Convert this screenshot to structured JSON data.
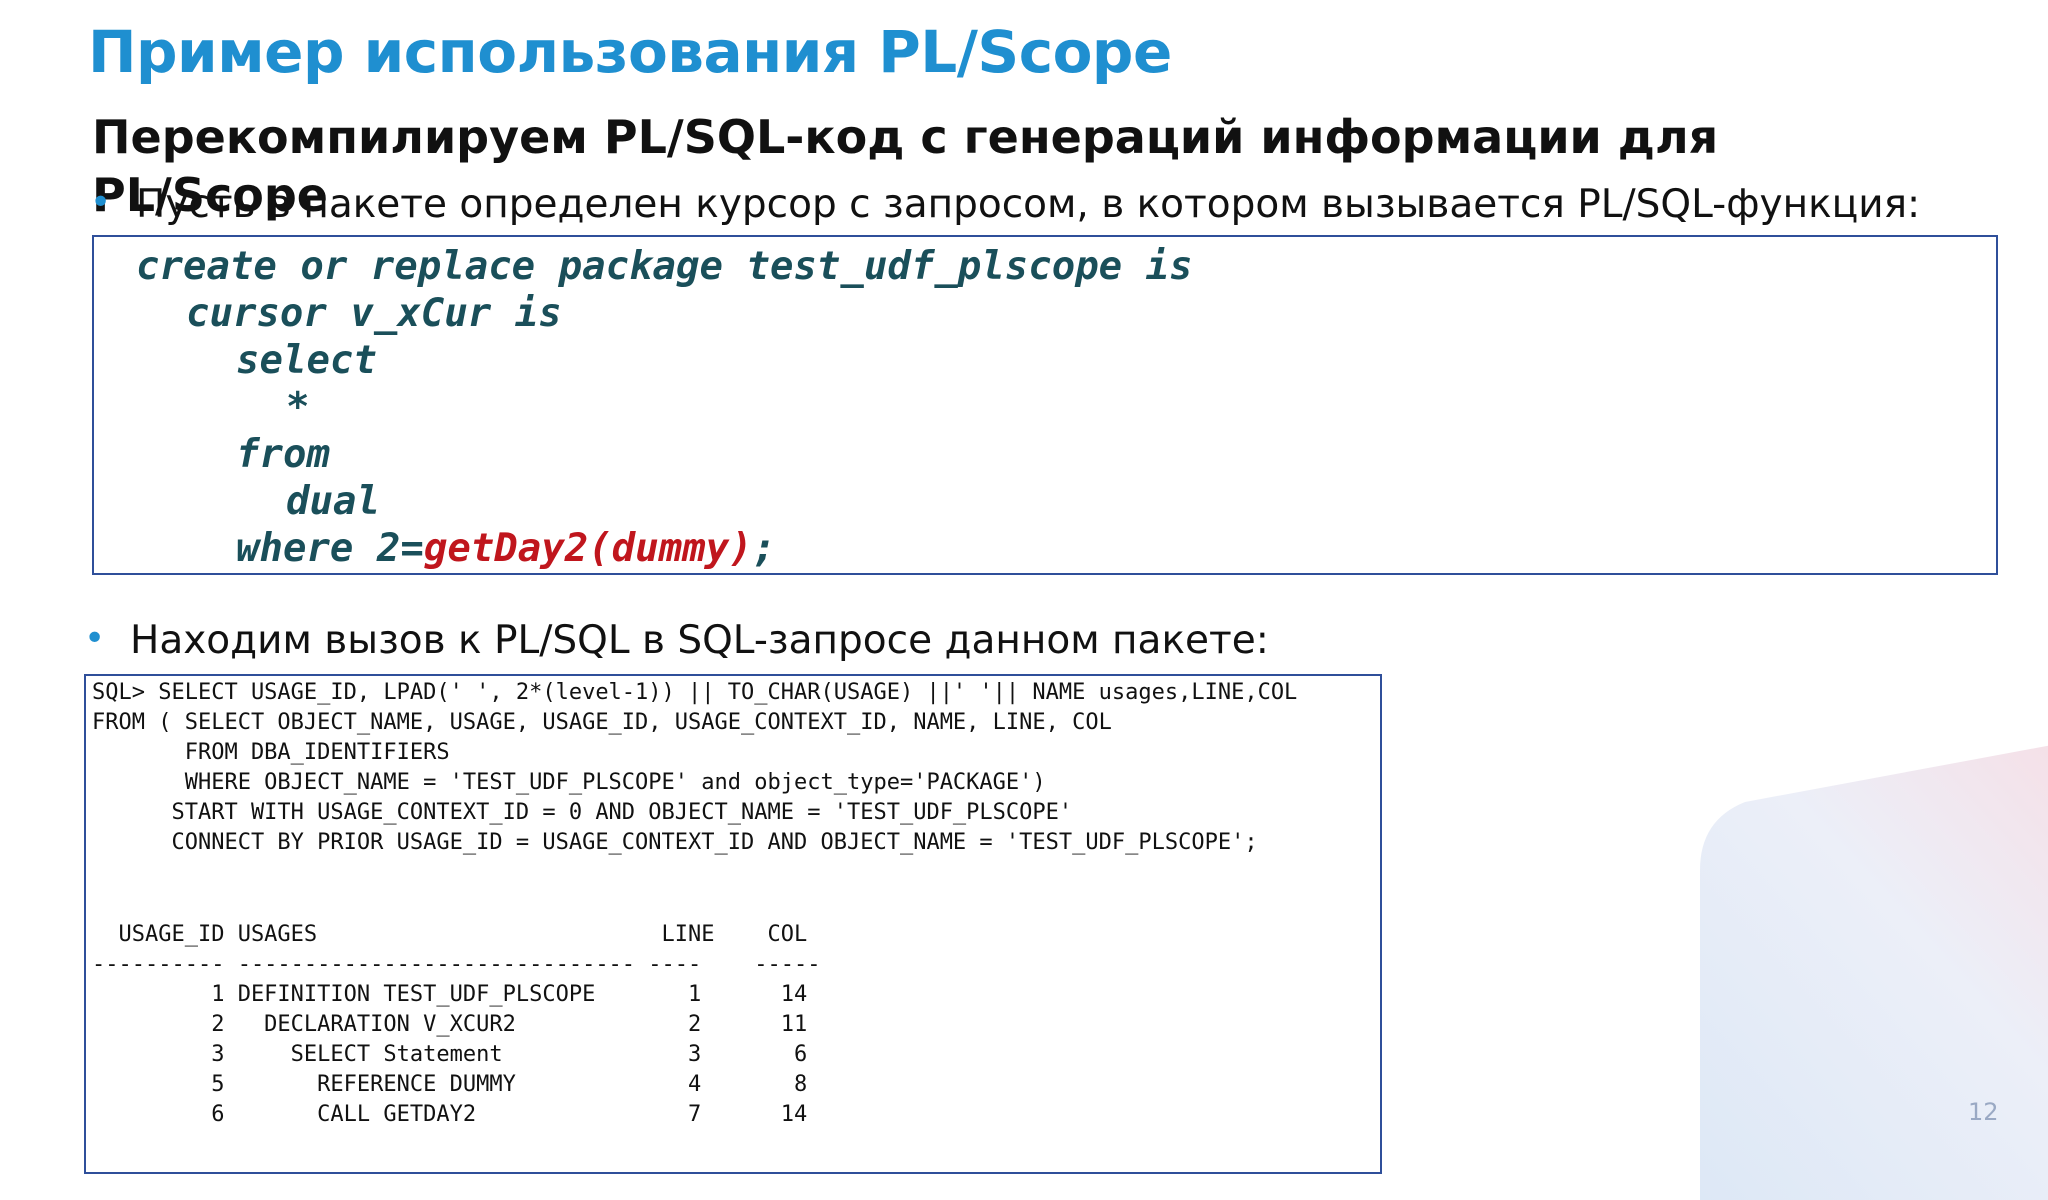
{
  "title": "Пример использования PL/Scope",
  "subtitle": "Перекомпилируем PL/SQL-код с генераций информации для PL/Scope",
  "bullets": [
    "Пусть в пакете определен курсор с запросом, в котором вызывается PL/SQL-функция:",
    "Находим вызов к PL/SQL в SQL-запросе данном пакете:"
  ],
  "code": {
    "lines": [
      "create or replace package test_udf_plscope is",
      "cursor v_xCur is",
      "select",
      "*",
      "from",
      "dual",
      "where 2="
    ],
    "call": "getDay2(dummy)",
    "call_end": ";"
  },
  "sql_lines": [
    "SQL> SELECT USAGE_ID, LPAD(' ', 2*(level-1)) || TO_CHAR(USAGE) ||' '|| NAME usages,LINE,COL",
    "FROM ( SELECT OBJECT_NAME, USAGE, USAGE_ID, USAGE_CONTEXT_ID, NAME, LINE, COL",
    "       FROM DBA_IDENTIFIERS",
    "       WHERE OBJECT_NAME = 'TEST_UDF_PLSCOPE' and object_type='PACKAGE')",
    "      START WITH USAGE_CONTEXT_ID = 0 AND OBJECT_NAME = 'TEST_UDF_PLSCOPE'",
    "      CONNECT BY PRIOR USAGE_ID = USAGE_CONTEXT_ID AND OBJECT_NAME = 'TEST_UDF_PLSCOPE';",
    "  USAGE_ID USAGES                          LINE    COL",
    "---------- ------------------------------ ----    -----",
    "         1 DEFINITION TEST_UDF_PLSCOPE       1      14",
    "         2   DECLARATION V_XCUR2             2      11",
    "         3     SELECT Statement              3       6",
    "         5       REFERENCE DUMMY             4       8",
    "         6       CALL GETDAY2                7      14"
  ],
  "page_number": "12",
  "colors": {
    "title": "#1f8fd0",
    "code": "#1a4f5a",
    "call": "#c0161d",
    "box_border": "#2f4f9a"
  }
}
